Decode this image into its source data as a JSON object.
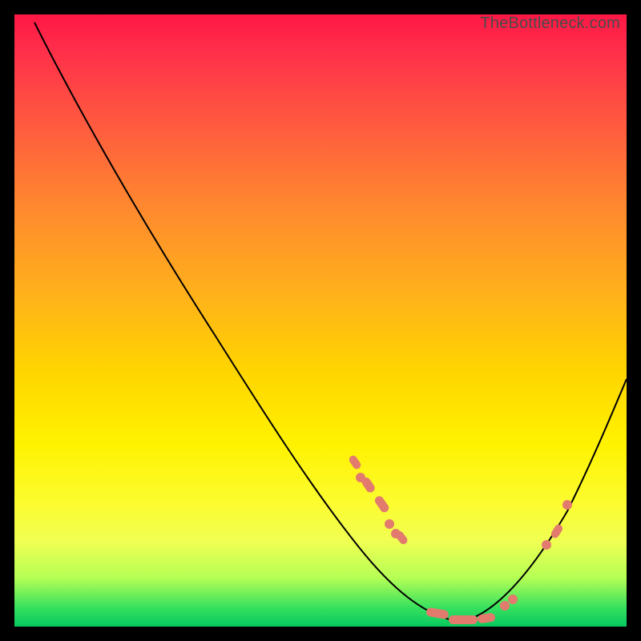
{
  "watermark": "TheBottleneck.com",
  "chart_data": {
    "type": "line",
    "title": "",
    "xlabel": "",
    "ylabel": "",
    "xlim": [
      0,
      100
    ],
    "ylim": [
      0,
      100
    ],
    "series": [
      {
        "name": "bottleneck-curve",
        "x": [
          0,
          10,
          20,
          30,
          40,
          50,
          55,
          60,
          65,
          70,
          75,
          80,
          85,
          90,
          95,
          100
        ],
        "y": [
          98,
          85,
          71,
          57,
          43,
          29,
          22,
          13,
          6,
          1,
          0,
          2,
          9,
          18,
          27,
          36
        ]
      }
    ],
    "markers": {
      "name": "highlighted-points",
      "x": [
        55,
        56,
        57,
        58,
        60,
        61,
        62,
        70,
        72,
        74,
        76,
        78,
        85,
        86,
        88
      ],
      "y": [
        22,
        21,
        20,
        18,
        13,
        12,
        11,
        1,
        0,
        0,
        1,
        2,
        9,
        11,
        15
      ]
    },
    "colors": {
      "curve": "#000000",
      "marker": "#e27b6e",
      "gradient_top": "#ff1745",
      "gradient_bottom": "#06c860"
    }
  }
}
